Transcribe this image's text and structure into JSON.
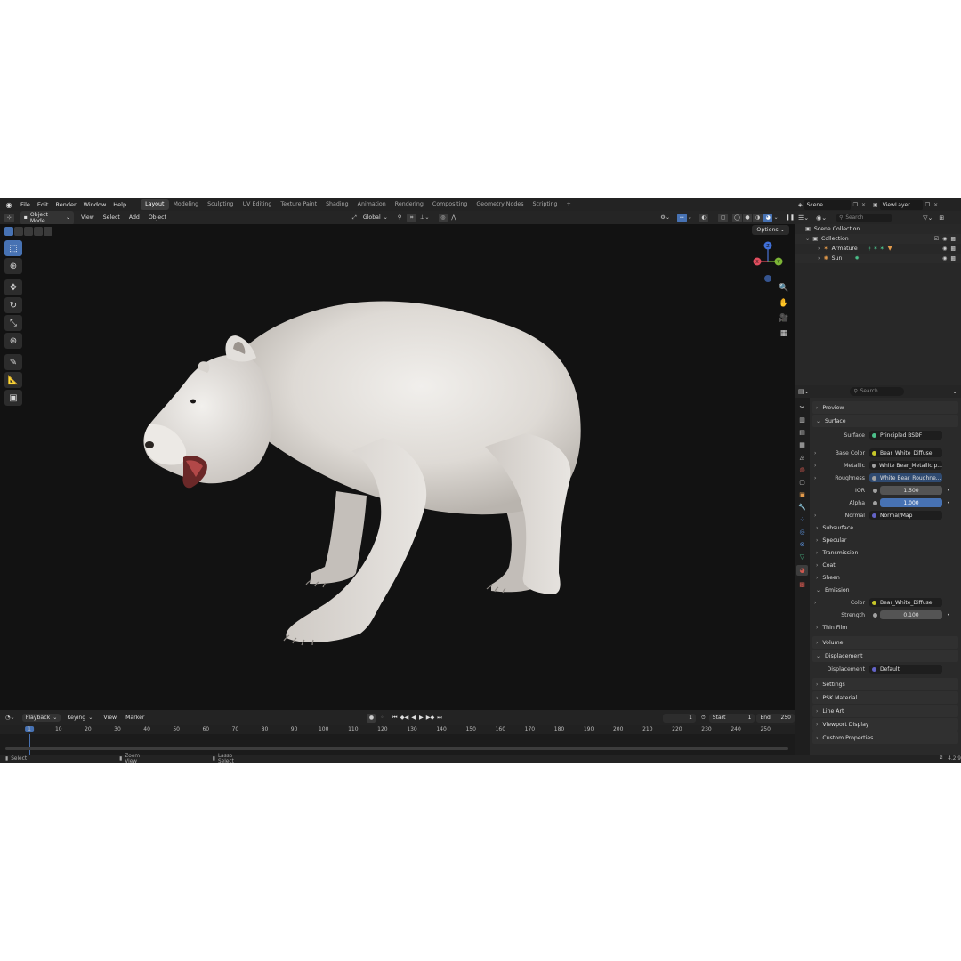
{
  "menu": [
    "File",
    "Edit",
    "Render",
    "Window",
    "Help"
  ],
  "workspaces": [
    "Layout",
    "Modeling",
    "Sculpting",
    "UV Editing",
    "Texture Paint",
    "Shading",
    "Animation",
    "Rendering",
    "Compositing",
    "Geometry Nodes",
    "Scripting"
  ],
  "active_workspace": "Layout",
  "scene_name": "Scene",
  "view_layer": "ViewLayer",
  "viewport_header": {
    "mode": "Object Mode",
    "view": "View",
    "select": "Select",
    "add": "Add",
    "object": "Object",
    "orientation": "Global"
  },
  "viewport": {
    "options": "Options",
    "gizmo": {
      "x": "X",
      "y": "Y",
      "z": "Z"
    }
  },
  "outliner": {
    "search_placeholder": "Search",
    "items": [
      {
        "label": "Scene Collection"
      },
      {
        "label": "Collection"
      },
      {
        "label": "Armature"
      },
      {
        "label": "Sun"
      }
    ]
  },
  "properties": {
    "search_placeholder": "Search",
    "sections": {
      "preview": "Preview",
      "surface": "Surface",
      "subsurface": "Subsurface",
      "specular": "Specular",
      "transmission": "Transmission",
      "coat": "Coat",
      "sheen": "Sheen",
      "emission": "Emission",
      "thin_film": "Thin Film",
      "volume": "Volume",
      "displacement": "Displacement",
      "settings": "Settings",
      "psk_material": "PSK Material",
      "line_art": "Line Art",
      "viewport_display": "Viewport Display",
      "custom_properties": "Custom Properties"
    },
    "rows": {
      "surface": {
        "label": "Surface",
        "value": "Principled BSDF"
      },
      "base_color": {
        "label": "Base Color",
        "value": "Bear_White_Diffuse"
      },
      "metallic": {
        "label": "Metallic",
        "value": "White Bear_Metallic.p..."
      },
      "roughness": {
        "label": "Roughness",
        "value": "White Bear_Roughne..."
      },
      "ior": {
        "label": "IOR",
        "value": "1.500"
      },
      "alpha": {
        "label": "Alpha",
        "value": "1.000"
      },
      "normal": {
        "label": "Normal",
        "value": "Normal/Map"
      },
      "emission_color": {
        "label": "Color",
        "value": "Bear_White_Diffuse"
      },
      "emission_strength": {
        "label": "Strength",
        "value": "0.100"
      },
      "displacement": {
        "label": "Displacement",
        "value": "Default"
      }
    }
  },
  "timeline": {
    "playback": "Playback",
    "keying": "Keying",
    "view": "View",
    "marker": "Marker",
    "current_frame": "1",
    "start_label": "Start",
    "start": "1",
    "end_label": "End",
    "end": "250",
    "frame_labels": [
      "1",
      "10",
      "20",
      "30",
      "40",
      "50",
      "60",
      "70",
      "80",
      "90",
      "100",
      "110",
      "120",
      "130",
      "140",
      "150",
      "160",
      "170",
      "180",
      "190",
      "200",
      "210",
      "220",
      "230",
      "240",
      "250"
    ]
  },
  "statusbar": {
    "select": "Select",
    "zoom_view": "Zoom View",
    "lasso_select": "Lasso Select",
    "version": "4.2.9"
  },
  "colors": {
    "accent": "#4772b3",
    "viewport_bg": "#121212",
    "panel_bg": "#2a2a2a"
  }
}
